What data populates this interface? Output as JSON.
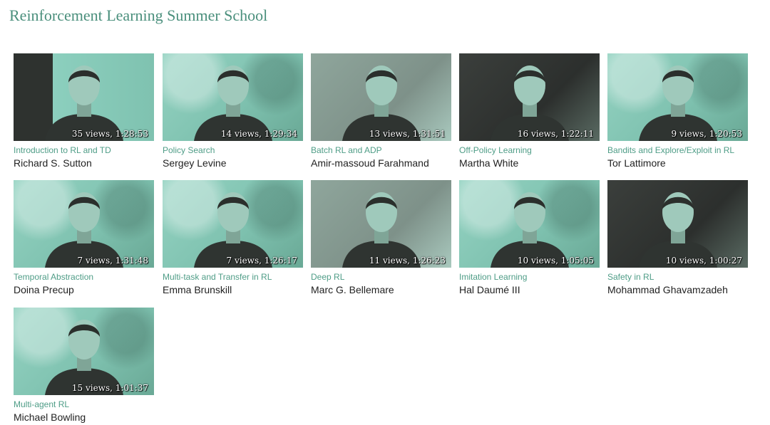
{
  "page": {
    "title": "Reinforcement Learning Summer School"
  },
  "lectures": [
    {
      "topic": "Introduction to RL and TD",
      "speaker": "Richard S. Sutton",
      "meta": "35 views, 1:28:53",
      "thumb_style": "mixed"
    },
    {
      "topic": "Policy Search",
      "speaker": "Sergey Levine",
      "meta": "14 views, 1:29:34",
      "thumb_style": "light"
    },
    {
      "topic": "Batch RL and ADP",
      "speaker": "Amir-massoud Farahmand",
      "meta": "13 views, 1:31:51",
      "thumb_style": "grey"
    },
    {
      "topic": "Off-Policy Learning",
      "speaker": "Martha White",
      "meta": "16 views, 1:22:11",
      "thumb_style": "dark"
    },
    {
      "topic": "Bandits and Explore/Exploit in RL",
      "speaker": "Tor Lattimore",
      "meta": "9 views, 1:20:53",
      "thumb_style": "light"
    },
    {
      "topic": "Temporal Abstraction",
      "speaker": "Doina Precup",
      "meta": "7 views, 1:31:48",
      "thumb_style": "light"
    },
    {
      "topic": "Multi-task and Transfer in RL",
      "speaker": "Emma Brunskill",
      "meta": "7 views, 1:26:17",
      "thumb_style": "light"
    },
    {
      "topic": "Deep RL",
      "speaker": "Marc G. Bellemare",
      "meta": "11 views, 1:26:23",
      "thumb_style": "grey"
    },
    {
      "topic": "Imitation Learning",
      "speaker": "Hal Daumé III",
      "meta": "10 views, 1:05:05",
      "thumb_style": "light"
    },
    {
      "topic": "Safety in RL",
      "speaker": "Mohammad Ghavamzadeh",
      "meta": "10 views, 1:00:27",
      "thumb_style": "dark"
    },
    {
      "topic": "Multi-agent RL",
      "speaker": "Michael Bowling",
      "meta": "15 views, 1:01:37",
      "thumb_style": "light"
    }
  ],
  "colors": {
    "title": "#4a8f7c",
    "topic_link": "#4f9d87",
    "speaker_text": "#222222",
    "thumbnail_tint": "#86c9b8"
  },
  "icons": {
    "thumbnail": "video-thumbnail-icon"
  }
}
